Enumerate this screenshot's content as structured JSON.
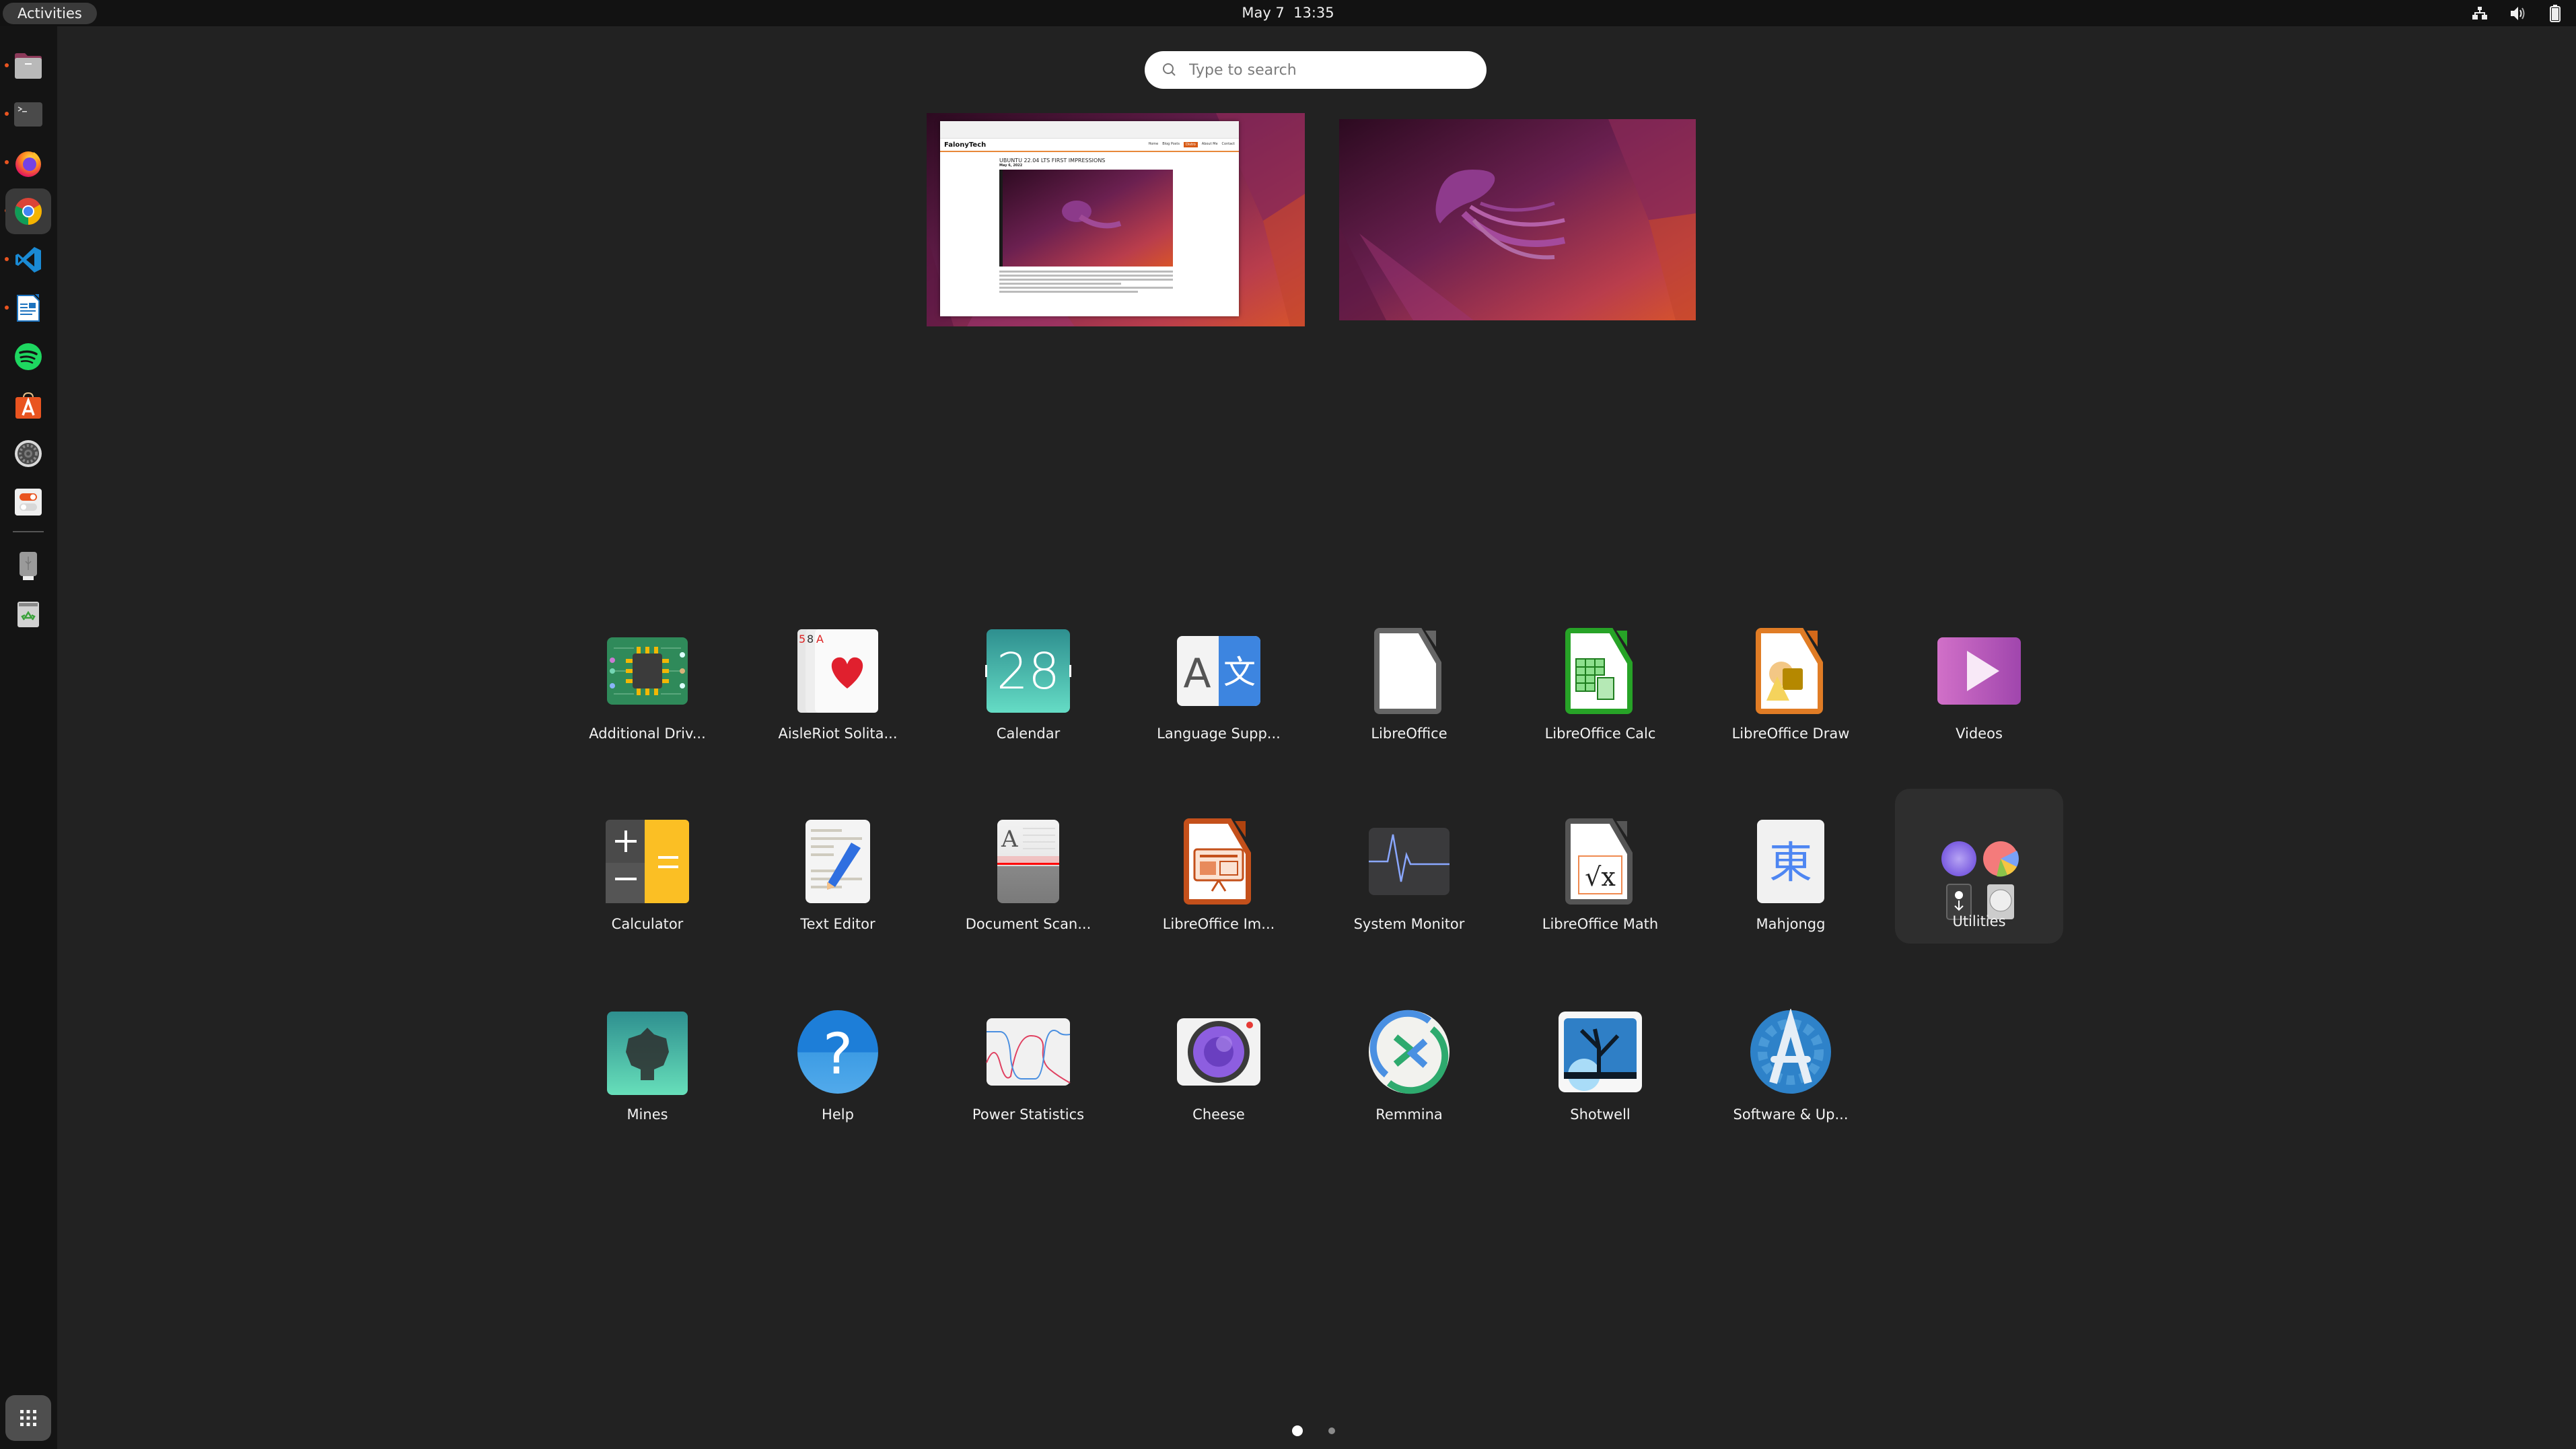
{
  "topbar": {
    "activities_label": "Activities",
    "clock": "May 7  13:35",
    "tray_icons": [
      "network-wired-icon",
      "volume-icon",
      "battery-icon"
    ]
  },
  "dock": {
    "items": [
      {
        "name": "Files",
        "icon": "files-icon",
        "running": true,
        "active": false
      },
      {
        "name": "Terminal",
        "icon": "terminal-icon",
        "running": true,
        "active": false
      },
      {
        "name": "Firefox",
        "icon": "firefox-icon",
        "running": true,
        "active": false
      },
      {
        "name": "Google Chrome",
        "icon": "chrome-icon",
        "running": true,
        "active": true
      },
      {
        "name": "Visual Studio Code",
        "icon": "vscode-icon",
        "running": true,
        "active": false
      },
      {
        "name": "LibreOffice Writer",
        "icon": "libreoffice-writer-icon",
        "running": true,
        "active": false
      },
      {
        "name": "Spotify",
        "icon": "spotify-icon",
        "running": false,
        "active": false
      },
      {
        "name": "Ubuntu Software",
        "icon": "ubuntu-software-icon",
        "running": false,
        "active": false
      },
      {
        "name": "Settings",
        "icon": "settings-icon",
        "running": false,
        "active": false
      },
      {
        "name": "Tweaks",
        "icon": "tweaks-icon",
        "running": false,
        "active": false
      }
    ],
    "mounts": [
      {
        "name": "USB Drive",
        "icon": "usb-drive-icon"
      },
      {
        "name": "Trash",
        "icon": "trash-icon"
      }
    ],
    "show_apps_label": "Show Applications"
  },
  "search": {
    "placeholder": "Type to search",
    "value": ""
  },
  "workspaces": [
    {
      "window": {
        "site_brand": "FalonyTech",
        "nav": [
          "Home",
          "Blog Posts",
          "Distro",
          "About Me",
          "Contact"
        ],
        "active_nav": "Distro",
        "headline": "UBUNTU 22.04 LTS FIRST IMPRESSIONS",
        "date": "May 6, 2022"
      }
    },
    {
      "window": null
    }
  ],
  "apps": [
    {
      "label": "Additional Driv...",
      "icon": "additional-drivers-icon"
    },
    {
      "label": "AisleRiot Solita...",
      "icon": "aisleriot-icon"
    },
    {
      "label": "Calendar",
      "icon": "calendar-icon",
      "icon_text": "28"
    },
    {
      "label": "Language Supp...",
      "icon": "language-support-icon",
      "icon_text_left": "A",
      "icon_text_right": "文"
    },
    {
      "label": "LibreOffice",
      "icon": "libreoffice-icon"
    },
    {
      "label": "LibreOffice Calc",
      "icon": "libreoffice-calc-icon"
    },
    {
      "label": "LibreOffice Draw",
      "icon": "libreoffice-draw-icon"
    },
    {
      "label": "Videos",
      "icon": "videos-icon"
    },
    {
      "label": "Calculator",
      "icon": "calculator-icon"
    },
    {
      "label": "Text Editor",
      "icon": "text-editor-icon"
    },
    {
      "label": "Document Scan...",
      "icon": "document-scanner-icon"
    },
    {
      "label": "LibreOffice Im...",
      "icon": "libreoffice-impress-icon"
    },
    {
      "label": "System Monitor",
      "icon": "system-monitor-icon"
    },
    {
      "label": "LibreOffice Math",
      "icon": "libreoffice-math-icon"
    },
    {
      "label": "Mahjongg",
      "icon": "mahjongg-icon",
      "icon_text": "東"
    },
    {
      "label": "Utilities",
      "icon": "utilities-folder-icon",
      "folder": true
    },
    {
      "label": "Mines",
      "icon": "mines-icon"
    },
    {
      "label": "Help",
      "icon": "help-icon",
      "icon_text": "?"
    },
    {
      "label": "Power Statistics",
      "icon": "power-statistics-icon"
    },
    {
      "label": "Cheese",
      "icon": "cheese-icon"
    },
    {
      "label": "Remmina",
      "icon": "remmina-icon"
    },
    {
      "label": "Shotwell",
      "icon": "shotwell-icon"
    },
    {
      "label": "Software & Up...",
      "icon": "software-updates-icon"
    }
  ],
  "pagination": {
    "pages": 2,
    "current": 1
  },
  "colors": {
    "accent": "#e95420",
    "overview_bg": "#222222",
    "panel_bg": "#121212"
  }
}
